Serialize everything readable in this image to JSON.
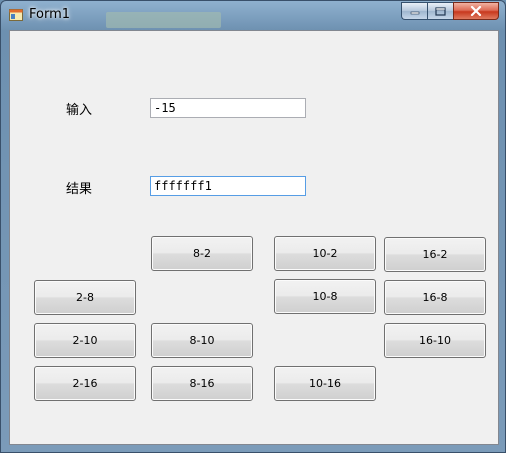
{
  "window": {
    "title": "Form1"
  },
  "form": {
    "input_label": "输入",
    "input_value": "-15",
    "result_label": "结果",
    "result_value": "fffffff1"
  },
  "buttons": {
    "b8_2": "8-2",
    "b10_2": "10-2",
    "b16_2": "16-2",
    "b2_8": "2-8",
    "b10_8": "10-8",
    "b16_8": "16-8",
    "b2_10": "2-10",
    "b8_10": "8-10",
    "b16_10": "16-10",
    "b2_16": "2-16",
    "b8_16": "8-16",
    "b10_16": "10-16"
  }
}
